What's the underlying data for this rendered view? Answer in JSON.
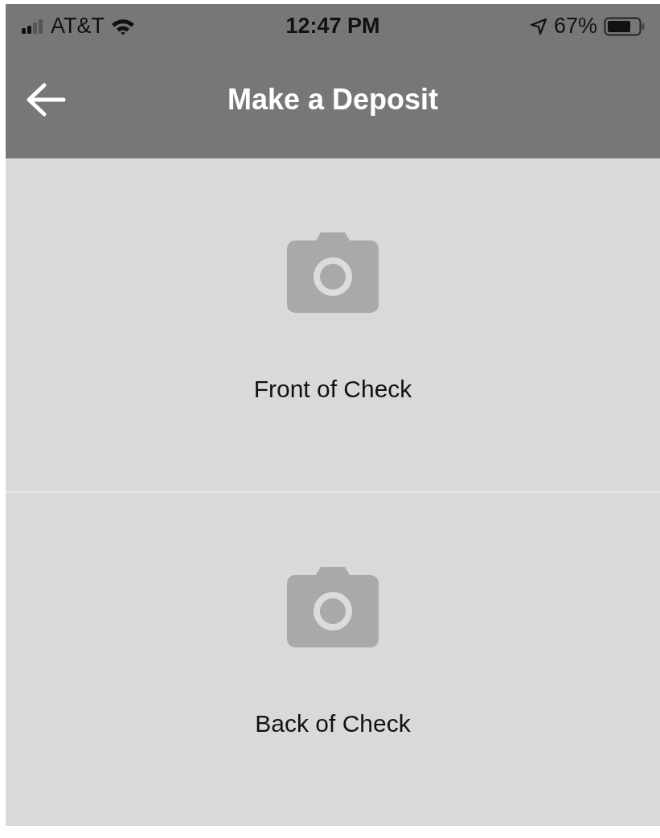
{
  "status_bar": {
    "carrier": "AT&T",
    "time": "12:47 PM",
    "battery": "67%"
  },
  "header": {
    "title": "Make a Deposit"
  },
  "capture_tiles": [
    {
      "label": "Front of Check"
    },
    {
      "label": "Back of Check"
    }
  ]
}
